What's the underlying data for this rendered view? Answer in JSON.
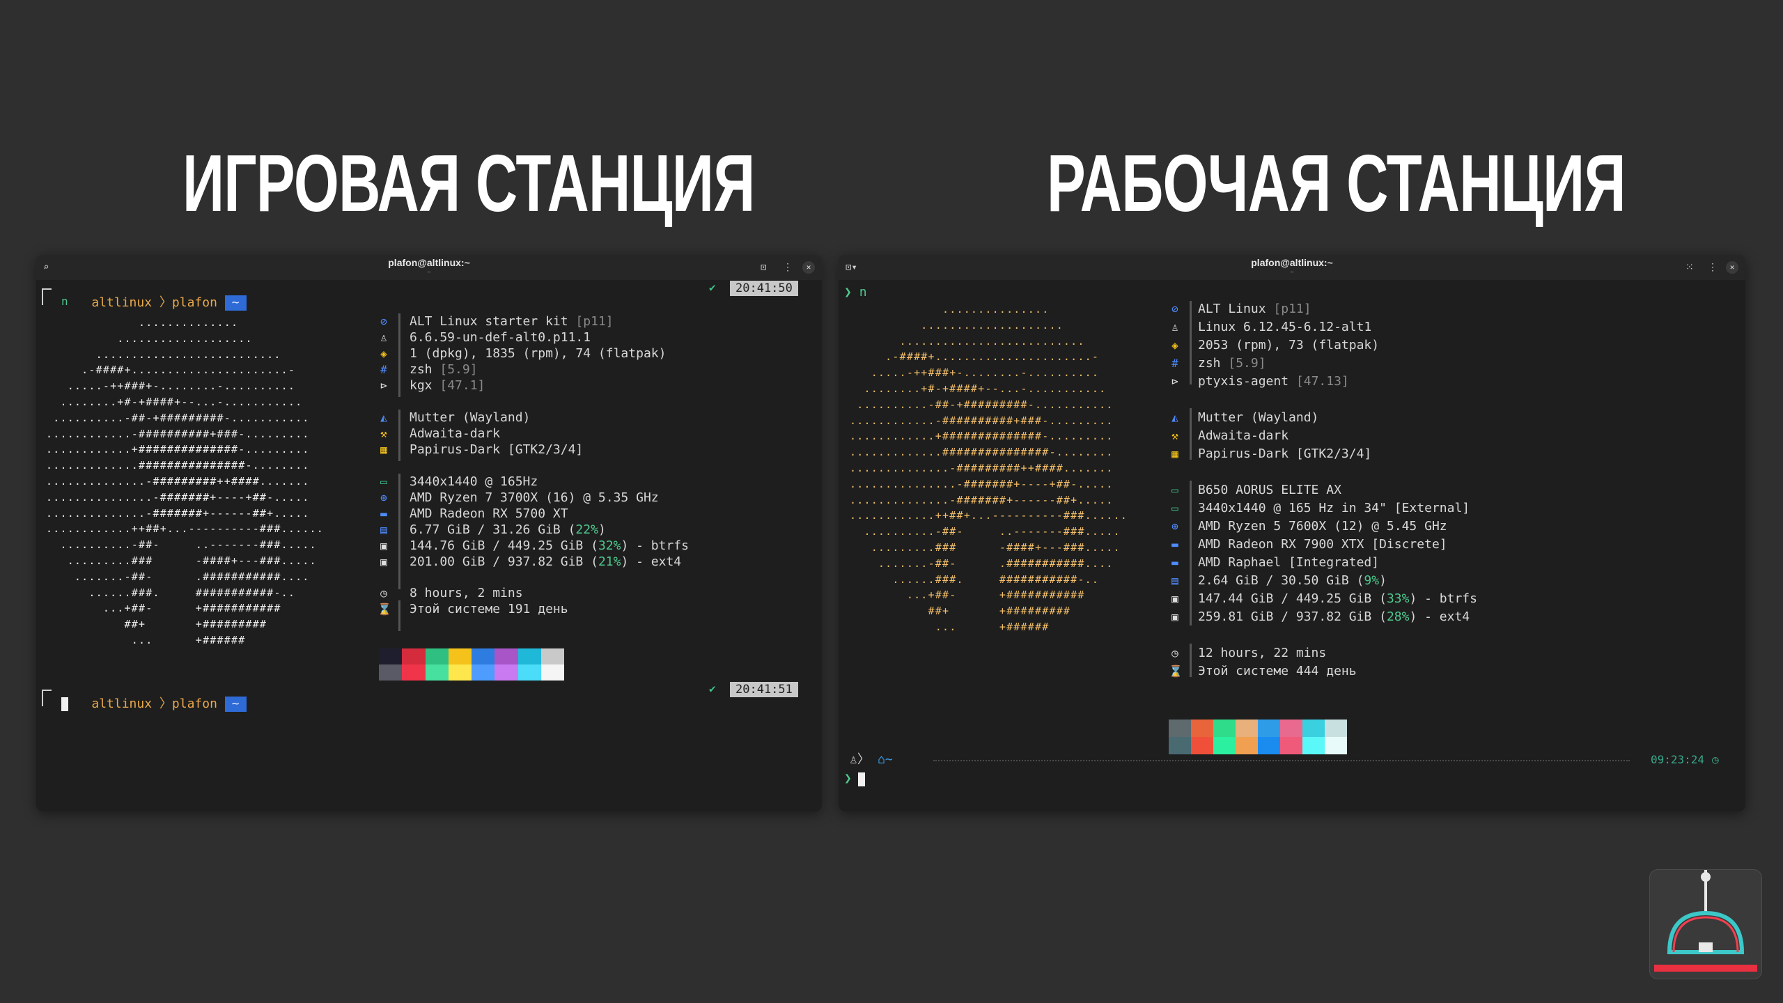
{
  "headings": {
    "left": "ИГРОВАЯ СТАНЦИЯ",
    "right": "РАБОЧАЯ СТАНЦИЯ"
  },
  "left_terminal": {
    "title": "plafon@altlinux:~",
    "subtitle": "~",
    "prompt1": {
      "host": "altlinux",
      "user": "plafon",
      "dir": "~",
      "time": "20:41:50",
      "cmd": "n"
    },
    "prompt2": {
      "host": "altlinux",
      "user": "plafon",
      "dir": "~",
      "time": "20:41:51"
    },
    "ascii_art": "             ..............\n          ...................\n       ..........................\n     .-####+......................-\n   .....-++###+-........-..........\n  ........+#-+####+--...-...........\n ..........-##-+#########-...........\n............-##########+###-.........\n............+##############-.........\n.............###############-........\n..............-#########++####.......\n...............-#######+----+##-.....\n..............-#######+------##+.....\n............++##+...----------###......\n  ..........-##-     ..-------###.....\n   .........###      -####+---###.....\n    .......-##-      .###########....\n      ......###.     ###########-..\n        ...+##-      +###########\n           ##+       +#########\n            ...      +######",
    "info": {
      "os": "ALT Linux starter kit",
      "os_tag": "[p11]",
      "kernel": "6.6.59-un-def-alt0.p11.1",
      "packages": "1 (dpkg), 1835 (rpm), 74 (flatpak)",
      "shell": "zsh",
      "shell_ver": "[5.9]",
      "terminal": "kgx",
      "terminal_ver": "[47.1]",
      "wm": "Mutter (Wayland)",
      "theme": "Adwaita-dark",
      "icons": "Papirus-Dark [GTK2/3/4]",
      "display": "3440x1440 @ 165Hz",
      "cpu": "AMD Ryzen 7 3700X (16) @ 5.35 GHz",
      "gpu": "AMD Radeon RX 5700 XT",
      "memory_pre": "6.77 GiB / 31.26 GiB (",
      "memory_pct": "22%",
      "memory_post": ")",
      "disk1_pre": "144.76 GiB / 449.25 GiB (",
      "disk1_pct": "32%",
      "disk1_post": ") - btrfs",
      "disk2_pre": "201.00 GiB / 937.82 GiB (",
      "disk2_pct": "21%",
      "disk2_post": ") - ext4",
      "uptime": "8 hours, 2 mins",
      "age": "Этой системе 191 день"
    },
    "icons": {
      "os": "altlinux-icon",
      "kernel": "linux-icon",
      "packages": "package-icon",
      "shell": "hash-icon",
      "terminal": "terminal-icon",
      "wm": "wm-icon",
      "theme": "brush-icon",
      "icons": "icons-icon",
      "display": "monitor-icon",
      "cpu": "cpu-icon",
      "gpu": "gpu-icon",
      "memory": "memory-icon",
      "disk": "disk-icon",
      "uptime": "clock-icon",
      "age": "hourglass-icon"
    },
    "palette_top": [
      "#1e1e2e",
      "#d42c3c",
      "#2fbf80",
      "#f4c21a",
      "#2f7ce0",
      "#a855c8",
      "#20b8d8",
      "#c9c9c9"
    ],
    "palette_bottom": [
      "#5a5a66",
      "#f0354a",
      "#48e09e",
      "#fde74c",
      "#4f9cff",
      "#c97af0",
      "#4adcf8",
      "#f5f5f5"
    ]
  },
  "right_terminal": {
    "title": "plafon@altlinux:~",
    "subtitle": "~",
    "cmd": "n",
    "prompt_time": "09:23:24",
    "prompt_dir": "~",
    "ascii_art": "             ...............\n          ....................\n       ..........................\n     .-####+......................-\n   .....-++###+-........-..........\n  ........+#-+####+--...-...........\n ..........-##-+#########-...........\n............-##########+###-.........\n............+##############-.........\n.............###############-........\n..............-#########++####.......\n...............-#######+----+##-.....\n..............-#######+------##+.....\n............++##+...----------###......\n  ..........-##-     ..-------###.....\n   .........###      -####+---###.....\n    .......-##-      .###########....\n      ......###.     ###########-..\n        ...+##-      +###########\n           ##+       +#########\n            ...      +######",
    "info": {
      "os": "ALT Linux",
      "os_tag": "[p11]",
      "kernel": "Linux 6.12.45-6.12-alt1",
      "packages": "2053 (rpm), 73 (flatpak)",
      "shell": "zsh",
      "shell_ver": "[5.9]",
      "terminal": "ptyxis-agent",
      "terminal_ver": "[47.13]",
      "wm": "Mutter (Wayland)",
      "theme": "Adwaita-dark",
      "icons": "Papirus-Dark [GTK2/3/4]",
      "board": "B650 AORUS ELITE AX",
      "display": "3440x1440 @ 165 Hz in 34\" [External]",
      "cpu": "AMD Ryzen 5 7600X (12) @ 5.45 GHz",
      "gpu1": "AMD Radeon RX 7900 XTX [Discrete]",
      "gpu2": "AMD Raphael [Integrated]",
      "memory_pre": "2.64 GiB / 30.50 GiB (",
      "memory_pct": "9%",
      "memory_post": ")",
      "disk1_pre": "147.44 GiB / 449.25 GiB (",
      "disk1_pct": "33%",
      "disk1_post": ") - btrfs",
      "disk2_pre": "259.81 GiB / 937.82 GiB (",
      "disk2_pct": "28%",
      "disk2_post": ") - ext4",
      "uptime": "12 hours, 22 mins",
      "age": "Этой системе 444 день"
    },
    "palette_top": [
      "#5e6a6e",
      "#e8643a",
      "#2fdc8a",
      "#e8b07a",
      "#2f9ce8",
      "#e86a8e",
      "#3ad0e0",
      "#c8e0e0"
    ],
    "palette_bottom": [
      "#4a6a72",
      "#f0503a",
      "#2af0a0",
      "#f0a050",
      "#1a8cf0",
      "#f05a7a",
      "#5af8f8",
      "#e8fafa"
    ]
  },
  "colors": {
    "accent_blue": "#2f6bd6",
    "accent_orange": "#e9a94b",
    "ok_green": "#3fc08a"
  }
}
